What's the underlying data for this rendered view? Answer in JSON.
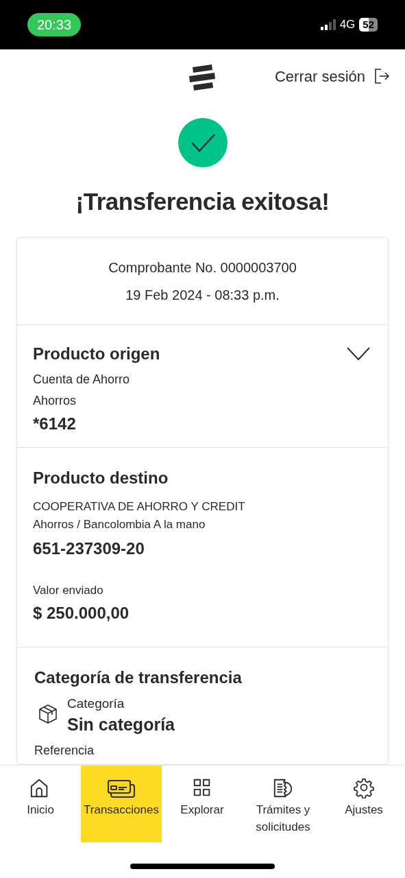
{
  "status_bar": {
    "time": "20:33",
    "network": "4G",
    "battery": "52"
  },
  "header": {
    "logout": "Cerrar sesión"
  },
  "title": "¡Transferencia exitosa!",
  "receipt": {
    "number": "Comprobante No. 0000003700",
    "date": "19 Feb 2024 - 08:33 p.m."
  },
  "origin": {
    "title": "Producto origen",
    "expanded": false,
    "lines": [
      "Cuenta de Ahorro",
      "Ahorros"
    ],
    "account": "*6142"
  },
  "destination": {
    "title": "Producto destino",
    "lines": [
      "COOPERATIVA DE AHORRO Y CREDIT",
      "Ahorros / Bancolombia A la mano"
    ],
    "account": "651-237309-20",
    "amount_label": "Valor enviado",
    "amount": "$ 250.000,00"
  },
  "category": {
    "title": "Categoría de transferencia",
    "label": "Categoría",
    "value": "Sin categoría",
    "reference_label": "Referencia"
  },
  "nav": [
    {
      "label": "Inicio",
      "selected": false
    },
    {
      "label": "Transacciones",
      "selected": true
    },
    {
      "label": "Explorar",
      "selected": false
    },
    {
      "label": "Trámites y solicitudes",
      "selected": false
    },
    {
      "label": "Ajustes",
      "selected": false
    }
  ]
}
